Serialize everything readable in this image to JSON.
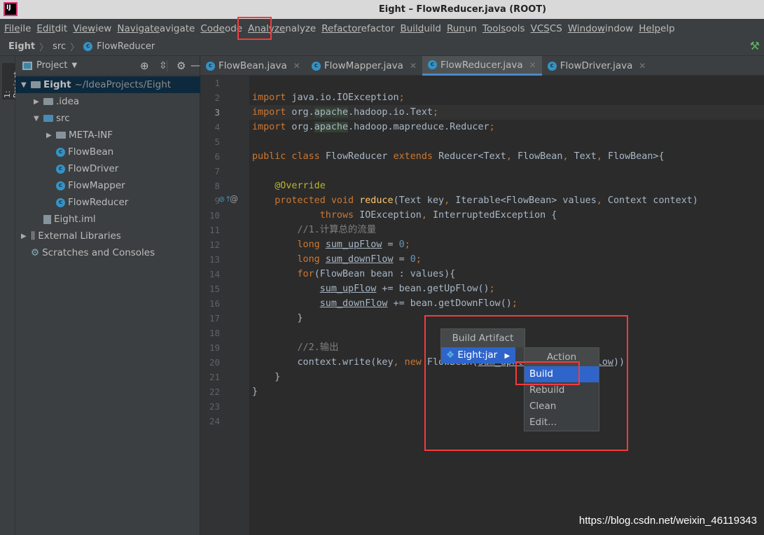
{
  "window": {
    "title": "Eight – FlowReducer.java (ROOT)",
    "logo": "IJ"
  },
  "menu": [
    "File",
    "Edit",
    "View",
    "Navigate",
    "Code",
    "Analyze",
    "Refactor",
    "Build",
    "Run",
    "Tools",
    "VCS",
    "Window",
    "Help"
  ],
  "breadcrumb": [
    "Eight",
    "src",
    "FlowReducer"
  ],
  "tool_strip": {
    "project_label": "1: Project"
  },
  "project": {
    "title": "Project",
    "tree": [
      {
        "label": "Eight",
        "extra": "~/IdeaProjects/Eight",
        "depth": 0,
        "kind": "module",
        "expanded": true,
        "selected": true
      },
      {
        "label": ".idea",
        "depth": 1,
        "kind": "folder",
        "expanded": false
      },
      {
        "label": "src",
        "depth": 1,
        "kind": "src-folder",
        "expanded": true
      },
      {
        "label": "META-INF",
        "depth": 2,
        "kind": "folder",
        "expanded": false
      },
      {
        "label": "FlowBean",
        "depth": 2,
        "kind": "class"
      },
      {
        "label": "FlowDriver",
        "depth": 2,
        "kind": "class"
      },
      {
        "label": "FlowMapper",
        "depth": 2,
        "kind": "class"
      },
      {
        "label": "FlowReducer",
        "depth": 2,
        "kind": "class"
      },
      {
        "label": "Eight.iml",
        "depth": 1,
        "kind": "file"
      },
      {
        "label": "External Libraries",
        "depth": 0,
        "kind": "libraries",
        "expanded": false
      },
      {
        "label": "Scratches and Consoles",
        "depth": 0,
        "kind": "scratches"
      }
    ]
  },
  "tabs": [
    {
      "label": "FlowBean.java"
    },
    {
      "label": "FlowMapper.java"
    },
    {
      "label": "FlowReducer.java",
      "active": true
    },
    {
      "label": "FlowDriver.java"
    }
  ],
  "code": [
    [],
    [
      [
        "import",
        "kw"
      ],
      [
        " java.io.IOException",
        ""
      ],
      [
        ";",
        "kw"
      ]
    ],
    [
      [
        "import",
        "kw"
      ],
      [
        " org.",
        ""
      ],
      [
        "apache",
        "pk"
      ],
      [
        ".hadoop.io.Text",
        ""
      ],
      [
        ";",
        "kw"
      ]
    ],
    [
      [
        "import",
        "kw"
      ],
      [
        " org.",
        ""
      ],
      [
        "apache",
        "pk"
      ],
      [
        ".hadoop.mapreduce.Reducer",
        ""
      ],
      [
        ";",
        "kw"
      ]
    ],
    [],
    [
      [
        "public class ",
        "kw"
      ],
      [
        "FlowReducer ",
        ""
      ],
      [
        "extends ",
        "kw"
      ],
      [
        "Reducer<Text",
        ""
      ],
      [
        ", ",
        "kw"
      ],
      [
        "FlowBean",
        ""
      ],
      [
        ", ",
        "kw"
      ],
      [
        "Text",
        ""
      ],
      [
        ", ",
        "kw"
      ],
      [
        "FlowBean>{",
        ""
      ]
    ],
    [],
    [
      [
        "    @Override",
        "an"
      ]
    ],
    [
      [
        "    protected void ",
        "kw"
      ],
      [
        "reduce",
        "fn"
      ],
      [
        "(Text key",
        ""
      ],
      [
        ", ",
        "kw"
      ],
      [
        "Iterable<FlowBean> values",
        ""
      ],
      [
        ", ",
        "kw"
      ],
      [
        "Context context)",
        ""
      ]
    ],
    [
      [
        "            throws ",
        "kw"
      ],
      [
        "IOException",
        ""
      ],
      [
        ", ",
        "kw"
      ],
      [
        "InterruptedException {",
        ""
      ]
    ],
    [
      [
        "        //1.计算总的流量",
        "cm"
      ]
    ],
    [
      [
        "        long ",
        "kw"
      ],
      [
        "sum_upFlow",
        "ul"
      ],
      [
        " = ",
        ""
      ],
      [
        "0",
        "nu"
      ],
      [
        ";",
        "kw"
      ]
    ],
    [
      [
        "        long ",
        "kw"
      ],
      [
        "sum_downFlow",
        "ul"
      ],
      [
        " = ",
        ""
      ],
      [
        "0",
        "nu"
      ],
      [
        ";",
        "kw"
      ]
    ],
    [
      [
        "        for",
        "kw"
      ],
      [
        "(FlowBean bean : values){",
        ""
      ]
    ],
    [
      [
        "            ",
        ""
      ],
      [
        "sum_upFlow",
        "ul"
      ],
      [
        " += bean.getUpFlow()",
        ""
      ],
      [
        ";",
        "kw"
      ]
    ],
    [
      [
        "            ",
        ""
      ],
      [
        "sum_downFlow",
        "ul"
      ],
      [
        " += bean.getDownFlow()",
        ""
      ],
      [
        ";",
        "kw"
      ]
    ],
    [
      [
        "        }",
        ""
      ]
    ],
    [],
    [
      [
        "        //2.输出",
        "cm"
      ]
    ],
    [
      [
        "        context.write(key",
        ""
      ],
      [
        ", ",
        "kw"
      ],
      [
        "new ",
        "kw"
      ],
      [
        "FlowBean(",
        ""
      ],
      [
        "sum_upFlow",
        "ul"
      ],
      [
        ", ",
        "kw"
      ],
      [
        "sum_downFlow",
        "ul"
      ],
      [
        "))",
        ""
      ],
      [
        ";",
        "kw"
      ]
    ],
    [
      [
        "    }",
        ""
      ]
    ],
    [
      [
        "}",
        ""
      ]
    ],
    [],
    []
  ],
  "popup_artifact": {
    "header": "Build Artifact",
    "items": [
      {
        "label": "Eight:jar",
        "selected": true
      }
    ]
  },
  "popup_action": {
    "header": "Action",
    "items": [
      {
        "label": "Build",
        "selected": true
      },
      {
        "label": "Rebuild"
      },
      {
        "label": "Clean"
      },
      {
        "label": "Edit..."
      }
    ]
  },
  "watermark": "https://blog.csdn.net/weixin_46119343",
  "colors": {
    "highlight": "#f43b3b",
    "selection": "#2f65ca"
  }
}
